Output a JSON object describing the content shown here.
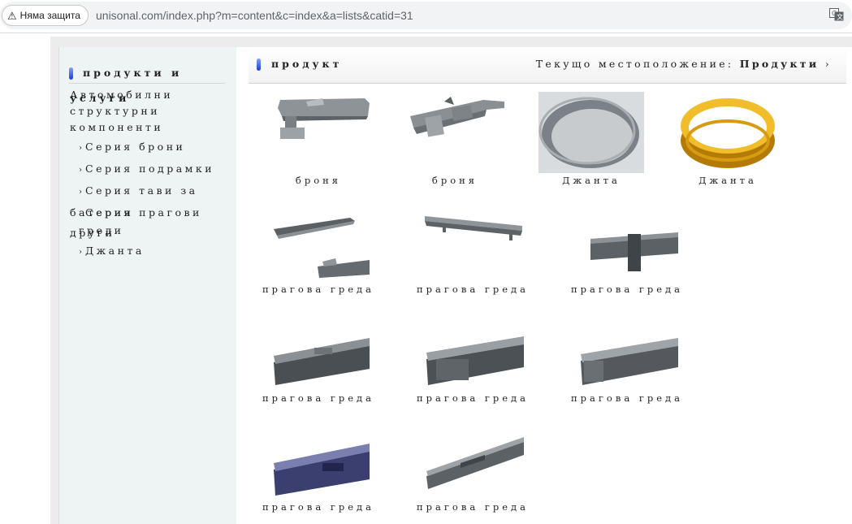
{
  "browser": {
    "security_label": "Няма защита",
    "url": "unisonal.com/index.php?m=content&c=index&a=lists&catid=31"
  },
  "sidebar": {
    "title_line1": "продукти и",
    "title_line2": "услуги",
    "category_lines": [
      "Автомобилни",
      "структурни",
      "компоненти"
    ],
    "items": [
      {
        "label": "Серия брони"
      },
      {
        "label": "Серия подрамки"
      },
      {
        "label": "Серия тави за"
      },
      {
        "label": "батерии"
      },
      {
        "label": "Серия прагови"
      },
      {
        "label": "греди"
      },
      {
        "label": "други"
      },
      {
        "label": "Джанта"
      }
    ]
  },
  "main": {
    "title": "продукт",
    "breadcrumb_prefix": "Текущо местоположение:",
    "breadcrumb_current": "Продукти",
    "breadcrumb_sep": "›"
  },
  "products": [
    {
      "name": "броня",
      "kind": "bumper"
    },
    {
      "name": "броня",
      "kind": "bumper2"
    },
    {
      "name": "Джанта",
      "kind": "rim-gray"
    },
    {
      "name": "Джанта",
      "kind": "rim-gold"
    },
    {
      "name": "прагова греда",
      "kind": "beam-long"
    },
    {
      "name": "прагова греда",
      "kind": "beam-flat"
    },
    {
      "name": "прагова греда",
      "kind": "beam-box"
    },
    {
      "name": "прагова греда",
      "kind": "beam-box2"
    },
    {
      "name": "прагова греда",
      "kind": "beam-box3"
    },
    {
      "name": "прагова греда",
      "kind": "beam-box4"
    },
    {
      "name": "прагова греда",
      "kind": "beam-purple"
    },
    {
      "name": "прагова греда",
      "kind": "beam-diag"
    }
  ],
  "colors": {
    "accent_blue": "#1b3fd0",
    "rim_gold": "#e0a414",
    "steel": "#6f7478"
  }
}
